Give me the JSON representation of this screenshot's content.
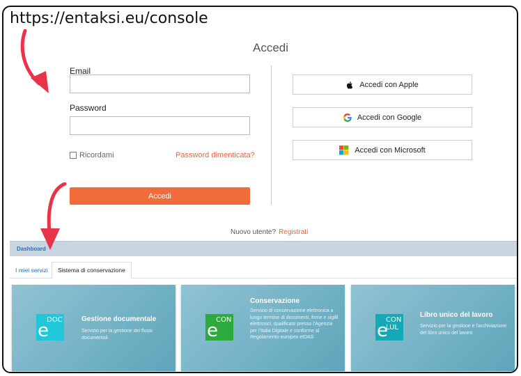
{
  "url_label": "https://entaksi.eu/console",
  "login": {
    "title": "Accedi",
    "email_label": "Email",
    "email_value": "",
    "password_label": "Password",
    "password_value": "",
    "remember_label": "Ricordami",
    "forgot_label": "Password dimenticata?",
    "submit_label": "Accedi"
  },
  "sso": {
    "apple_label": "Accedi con Apple",
    "google_label": "Accedi con Google",
    "microsoft_label": "Accedi con Microsoft"
  },
  "register": {
    "question": "Nuovo utente?",
    "link": "Registrati"
  },
  "dashboard": {
    "breadcrumb": "Dashboard",
    "tabs": [
      {
        "label": "I miei servizi"
      },
      {
        "label": "Sistema di conservazione"
      }
    ],
    "cards": [
      {
        "logo_main": "e",
        "logo_sup": "DOC",
        "logo_color": "#1ec8d8",
        "title": "Gestione documentale",
        "description": "Servizio per la gestione dei flussi documentali"
      },
      {
        "logo_main": "e",
        "logo_sup": "CON",
        "logo_color": "#2daa3d",
        "title": "Conservazione",
        "description": "Servizio di conservazione elettronica a lungo termine di documenti, firme e sigilli elettronici, qualificato presso l'Agenzia per l'Italia Digitale e conforme al Regolamento europeo eIDAS"
      },
      {
        "logo_main": "e",
        "logo_sup": "CON LUL",
        "logo_color": "#15a9b8",
        "title": "Libro unico del lavoro",
        "description": "Servizio per la gestione e l'archiviazione del libro unico del lavoro"
      }
    ]
  },
  "colors": {
    "accent": "#f26b3a",
    "annotation_arrow": "#e8344a",
    "card_bg": "#7db7c9",
    "link_blue": "#2a6fb5"
  }
}
